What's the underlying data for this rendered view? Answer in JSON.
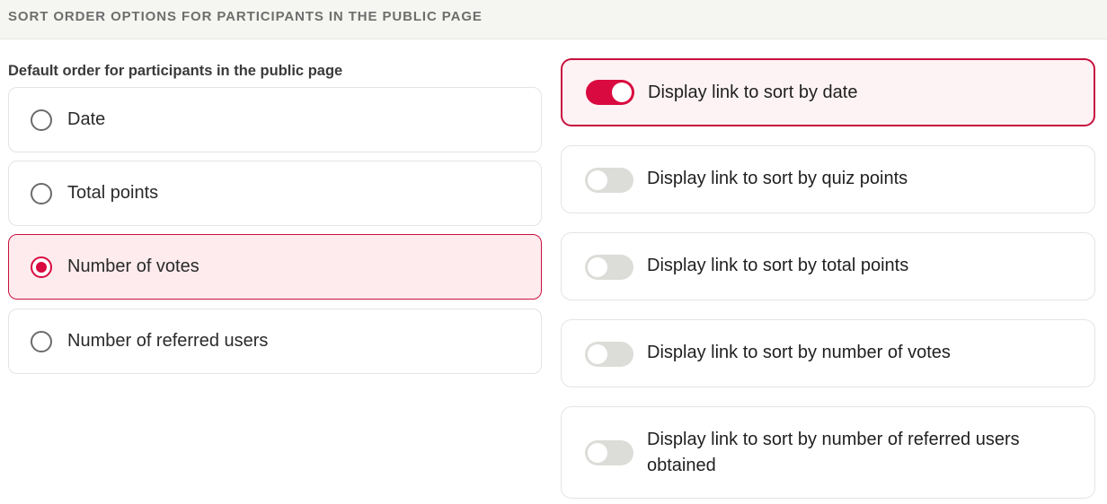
{
  "section": {
    "title": "SORT ORDER OPTIONS FOR PARTICIPANTS IN THE PUBLIC PAGE"
  },
  "default_order": {
    "label": "Default order for participants in the public page",
    "options": [
      {
        "label": "Date",
        "selected": false
      },
      {
        "label": "Total points",
        "selected": false
      },
      {
        "label": "Number of votes",
        "selected": true
      },
      {
        "label": "Number of referred users",
        "selected": false
      }
    ]
  },
  "sort_links": [
    {
      "label": "Display link to sort by date",
      "enabled": true
    },
    {
      "label": "Display link to sort by quiz points",
      "enabled": false
    },
    {
      "label": "Display link to sort by total points",
      "enabled": false
    },
    {
      "label": "Display link to sort by number of votes",
      "enabled": false
    },
    {
      "label": "Display link to sort by number of referred users obtained",
      "enabled": false
    }
  ],
  "colors": {
    "accent": "#d90a3f",
    "selected_background": "#fdebee",
    "header_background": "#f5f5f2"
  }
}
